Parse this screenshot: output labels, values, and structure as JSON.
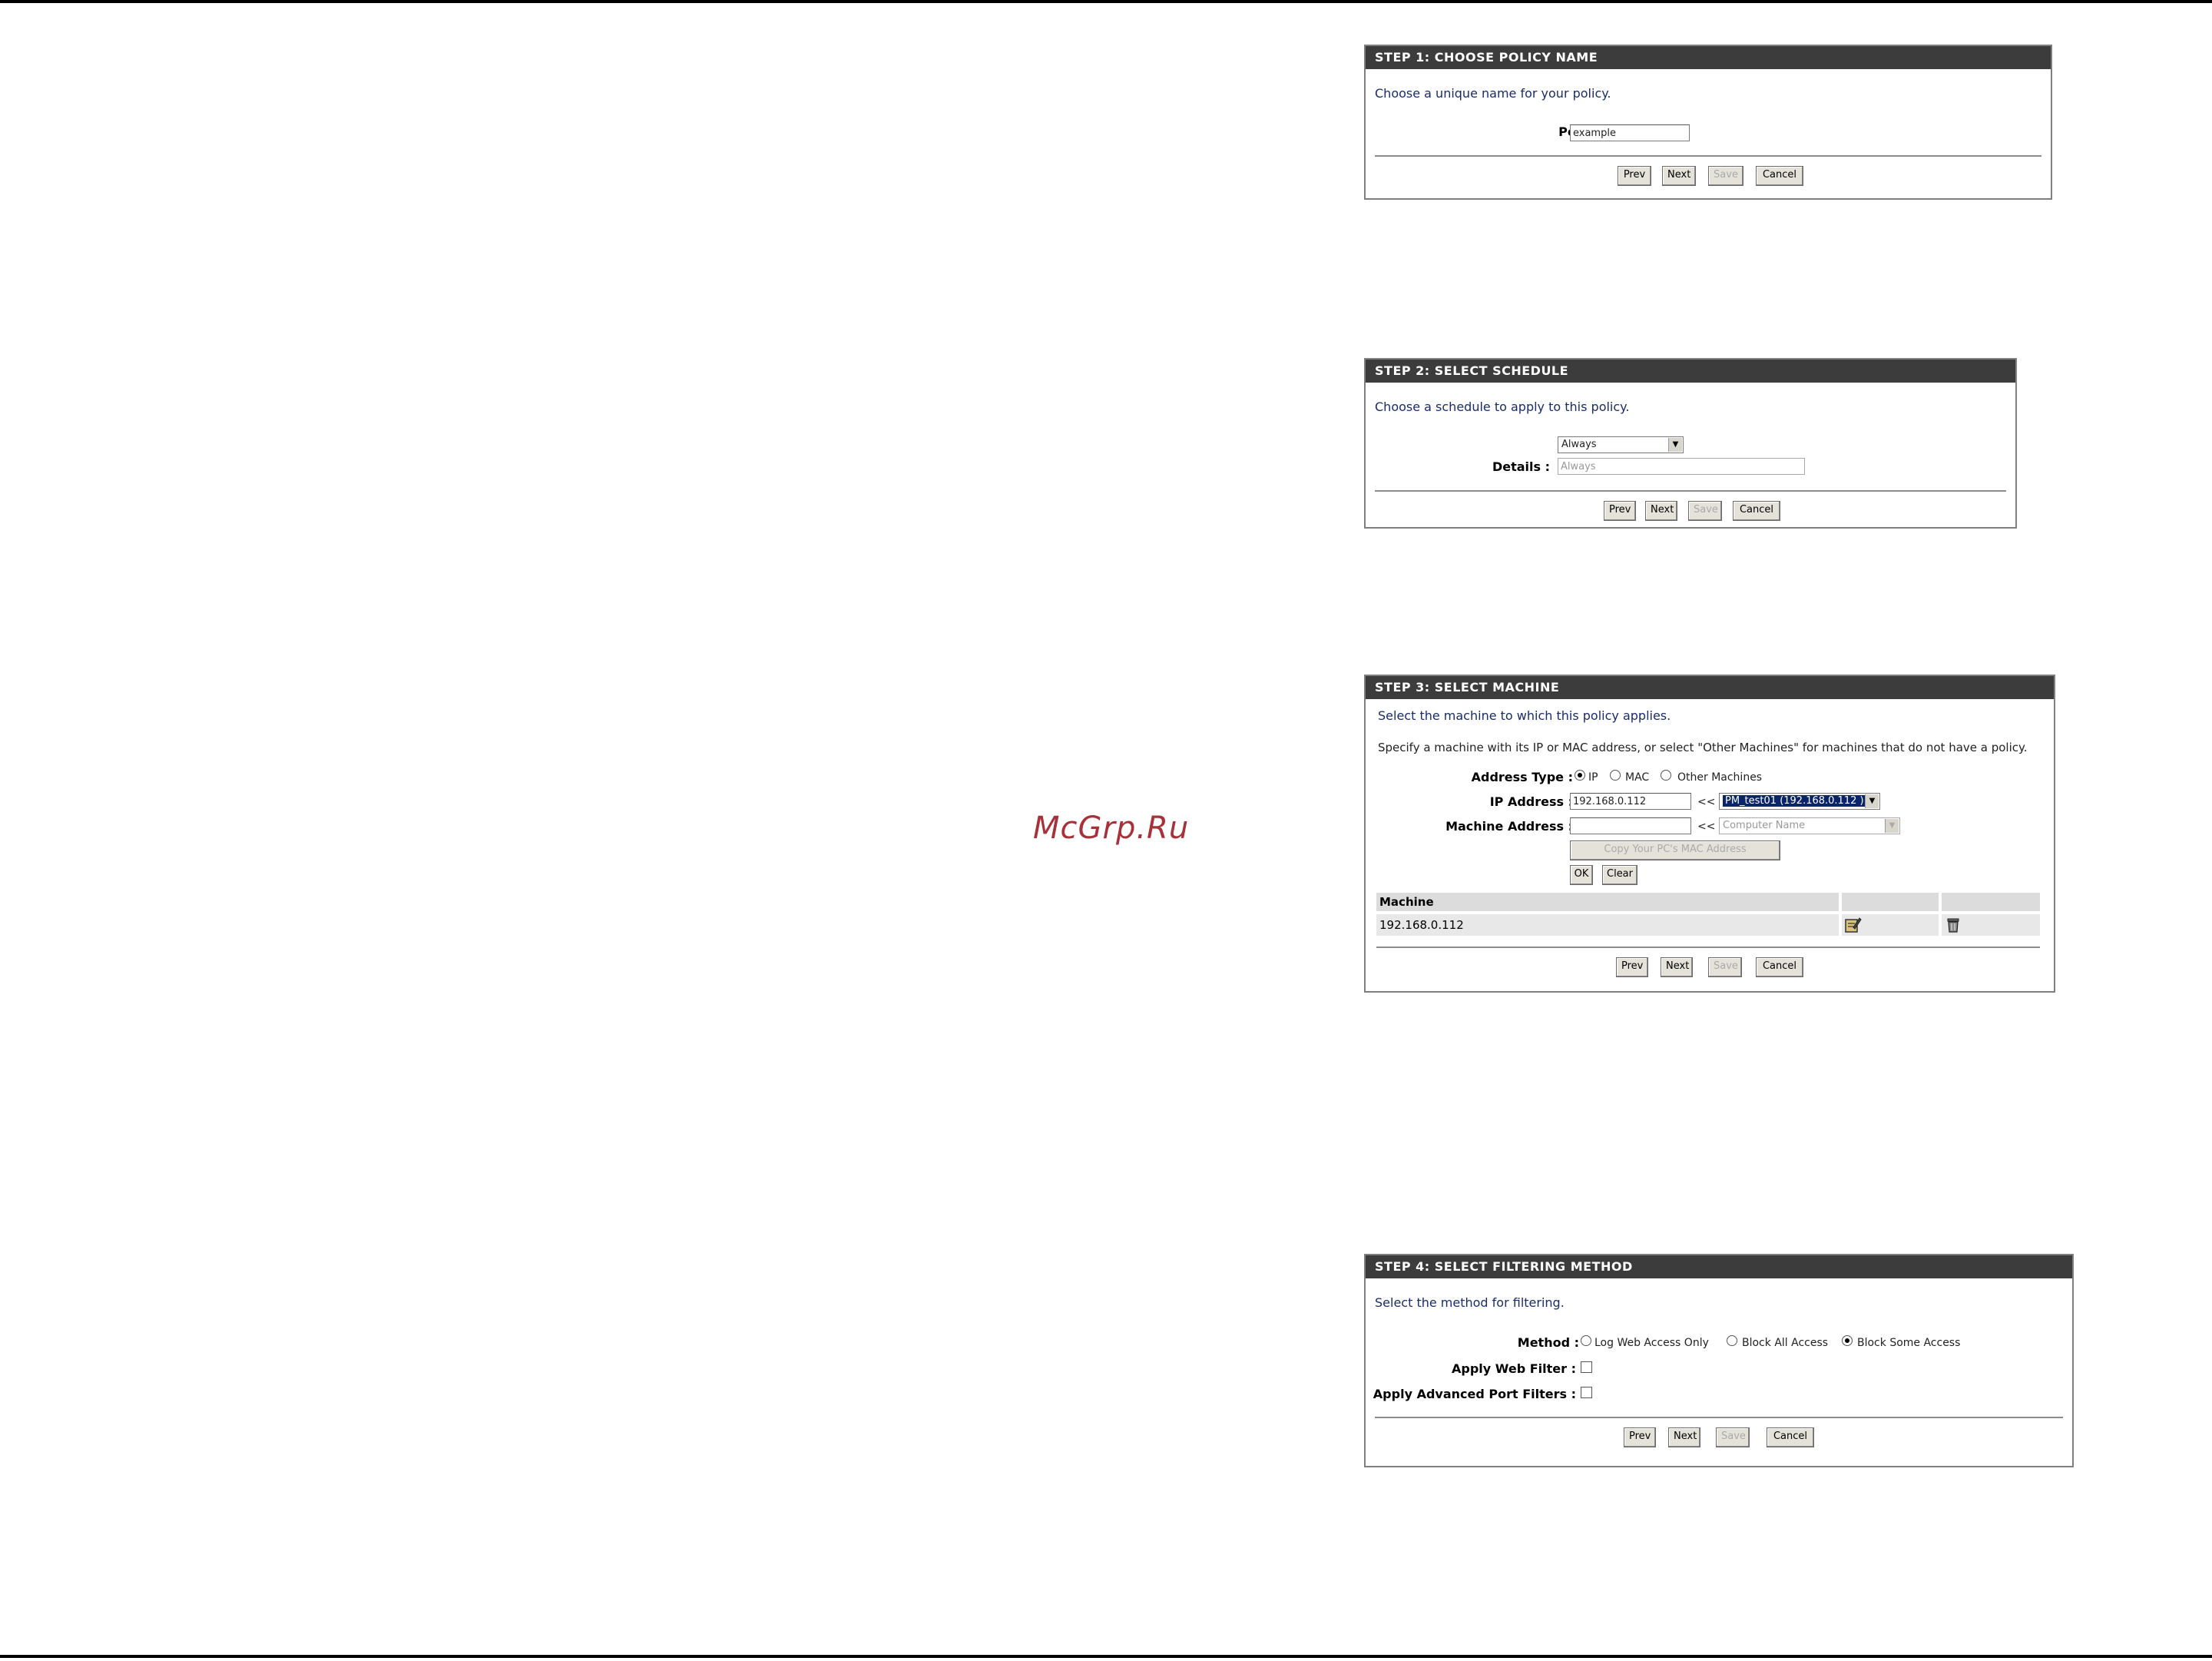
{
  "watermark": "McGrp.Ru",
  "step1": {
    "title": "STEP 1: CHOOSE POLICY NAME",
    "intro": "Choose a unique name for your policy.",
    "policy_name_label": "Policy Name :",
    "policy_name_value": "example",
    "buttons": {
      "prev": "Prev",
      "next": "Next",
      "save": "Save",
      "cancel": "Cancel"
    }
  },
  "step2": {
    "title": "STEP 2: SELECT SCHEDULE",
    "intro": "Choose a schedule to apply to this policy.",
    "schedule_value": "Always",
    "details_label": "Details :",
    "details_value": "Always",
    "buttons": {
      "prev": "Prev",
      "next": "Next",
      "save": "Save",
      "cancel": "Cancel"
    }
  },
  "step3": {
    "title": "STEP 3: SELECT MACHINE",
    "intro": "Select the machine to which this policy applies.",
    "description": "Specify a machine with its IP or MAC address, or select \"Other Machines\" for machines that do not have a policy.",
    "address_type_label": "Address Type :",
    "address_types": [
      "IP",
      "MAC",
      "Other Machines"
    ],
    "address_type_selected": "IP",
    "ip_label": "IP Address :",
    "ip_value": "192.168.0.112",
    "arrow_label": "<<",
    "ip_select_value": "PM_test01 (192.168.0.112 )",
    "machine_label": "Machine Address :",
    "machine_value": "",
    "machine_select_value": "Computer Name",
    "copy_mac_button": "Copy Your PC's MAC Address",
    "ok_button": "OK",
    "clear_button": "Clear",
    "table_header": "Machine",
    "table_rows": [
      {
        "machine": "192.168.0.112"
      }
    ],
    "buttons": {
      "prev": "Prev",
      "next": "Next",
      "save": "Save",
      "cancel": "Cancel"
    }
  },
  "step4": {
    "title": "STEP 4: SELECT FILTERING METHOD",
    "intro": "Select the method for filtering.",
    "method_label": "Method :",
    "methods": [
      "Log Web Access Only",
      "Block All Access",
      "Block Some Access"
    ],
    "method_selected": "Block Some Access",
    "web_filter_label": "Apply Web Filter :",
    "web_filter_checked": false,
    "port_filter_label": "Apply Advanced Port Filters :",
    "port_filter_checked": false,
    "buttons": {
      "prev": "Prev",
      "next": "Next",
      "save": "Save",
      "cancel": "Cancel"
    }
  }
}
